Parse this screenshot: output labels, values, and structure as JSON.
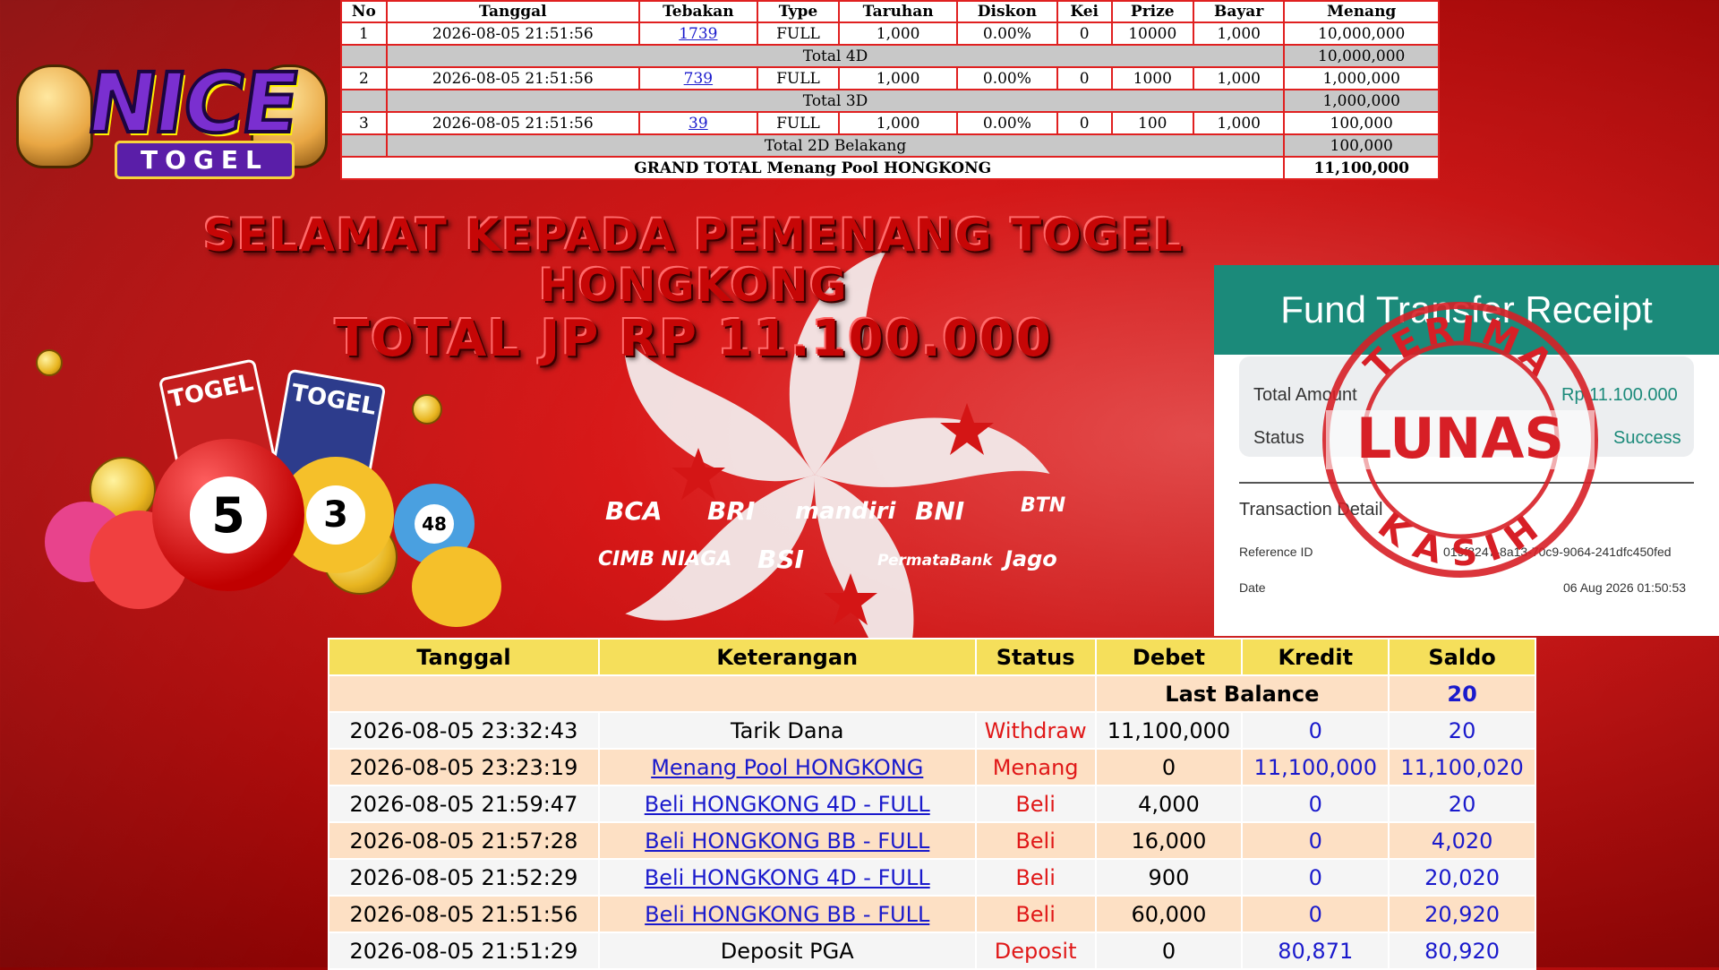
{
  "logo": {
    "word1": "NICE",
    "word2": "TOGEL"
  },
  "win_table": {
    "headers": [
      "No",
      "Tanggal",
      "Tebakan",
      "Type",
      "Taruhan",
      "Diskon",
      "Kei",
      "Prize",
      "Bayar",
      "Menang"
    ],
    "rows": [
      {
        "no": "1",
        "tanggal": "2026-08-05 21:51:56",
        "tebakan": "1739",
        "type": "FULL",
        "taruhan": "1,000",
        "diskon": "0.00%",
        "kei": "0",
        "prize": "10000",
        "bayar": "1,000",
        "menang": "10,000,000"
      },
      {
        "no": "2",
        "tanggal": "2026-08-05 21:51:56",
        "tebakan": "739",
        "type": "FULL",
        "taruhan": "1,000",
        "diskon": "0.00%",
        "kei": "0",
        "prize": "1000",
        "bayar": "1,000",
        "menang": "1,000,000"
      },
      {
        "no": "3",
        "tanggal": "2026-08-05 21:51:56",
        "tebakan": "39",
        "type": "FULL",
        "taruhan": "1,000",
        "diskon": "0.00%",
        "kei": "0",
        "prize": "100",
        "bayar": "1,000",
        "menang": "100,000"
      }
    ],
    "totals": [
      {
        "label": "Total 4D",
        "value": "10,000,000"
      },
      {
        "label": "Total 3D",
        "value": "1,000,000"
      },
      {
        "label": "Total 2D Belakang",
        "value": "100,000"
      }
    ],
    "grand_total_label": "GRAND TOTAL  Menang Pool HONGKONG",
    "grand_total_value": "11,100,000"
  },
  "headline": {
    "line1": "Selamat kepada pemenang Togel",
    "line2": "Hongkong",
    "line3": "Total JP Rp 11.100.000"
  },
  "illustration": {
    "card1": "TOGEL",
    "card2": "TOGEL",
    "ball_big": "5",
    "ball_mid": "3",
    "ball_small": "48"
  },
  "banks": [
    "BCA",
    "BRI",
    "mandiri",
    "BNI",
    "BTN",
    "CIMB NIAGA",
    "BSI",
    "PermataBank",
    "Jago"
  ],
  "receipt": {
    "title": "Fund Transfer Receipt",
    "total_amount_label": "Total Amount",
    "total_amount_value": "Rp 11.100.000",
    "status_label": "Status",
    "status_value": "Success",
    "section": "Transaction Detail",
    "reference_label": "Reference ID",
    "reference_value": "019f8247-8a13-70c9-9064-241dfc450fed",
    "date_label": "Date",
    "date_value": "06 Aug 2026 01:50:53",
    "stamp_top": "TERIMA",
    "stamp_mid": "LUNAS",
    "stamp_bottom": "KASIH"
  },
  "mutasi": {
    "headers": [
      "Tanggal",
      "Keterangan",
      "Status",
      "Debet",
      "Kredit",
      "Saldo"
    ],
    "last_balance_label": "Last Balance",
    "last_balance_value": "20",
    "rows": [
      {
        "tanggal": "2026-08-05 23:32:43",
        "keterangan": "Tarik Dana",
        "status": "Withdraw",
        "debet": "11,100,000",
        "kredit": "0",
        "saldo": "20"
      },
      {
        "tanggal": "2026-08-05 23:23:19",
        "keterangan": "Menang Pool HONGKONG",
        "status": "Menang",
        "debet": "0",
        "kredit": "11,100,000",
        "saldo": "11,100,020"
      },
      {
        "tanggal": "2026-08-05 21:59:47",
        "keterangan": "Beli HONGKONG 4D - FULL",
        "status": "Beli",
        "debet": "4,000",
        "kredit": "0",
        "saldo": "20"
      },
      {
        "tanggal": "2026-08-05 21:57:28",
        "keterangan": "Beli HONGKONG BB - FULL",
        "status": "Beli",
        "debet": "16,000",
        "kredit": "0",
        "saldo": "4,020"
      },
      {
        "tanggal": "2026-08-05 21:52:29",
        "keterangan": "Beli HONGKONG 4D - FULL",
        "status": "Beli",
        "debet": "900",
        "kredit": "0",
        "saldo": "20,020"
      },
      {
        "tanggal": "2026-08-05 21:51:56",
        "keterangan": "Beli HONGKONG BB - FULL",
        "status": "Beli",
        "debet": "60,000",
        "kredit": "0",
        "saldo": "20,920"
      },
      {
        "tanggal": "2026-08-05 21:51:29",
        "keterangan": "Deposit PGA",
        "status": "Deposit",
        "debet": "0",
        "kredit": "80,871",
        "saldo": "80,920"
      }
    ]
  },
  "colors": {
    "accent_red": "#e01818",
    "teal": "#1b8a7a",
    "link_blue": "#1a1acc",
    "header_yellow": "#f5df5b"
  }
}
